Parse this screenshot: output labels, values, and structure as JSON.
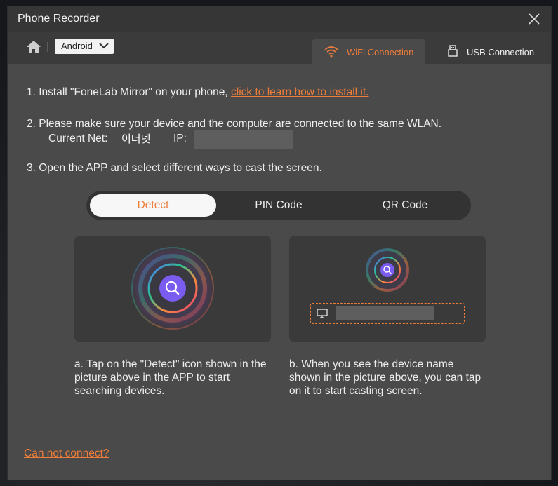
{
  "window": {
    "title": "Phone Recorder"
  },
  "toolbar": {
    "os_selected": "Android",
    "tabs": {
      "wifi": "WiFi Connection",
      "usb": "USB Connection"
    }
  },
  "steps": {
    "step1_text": "1. Install \"FoneLab Mirror\" on your phone, ",
    "step1_link": "click to learn how to install it.",
    "step2_text": "2. Please make sure your device and the computer are connected to the same WLAN.",
    "current_net_label": "Current Net:",
    "current_net_value": "이더넷",
    "ip_label": "IP:",
    "step3_text": "3. Open the APP and select different ways to cast the screen."
  },
  "methods": {
    "detect": "Detect",
    "pin": "PIN Code",
    "qr": "QR Code",
    "active": "Detect"
  },
  "captions": {
    "a": "a. Tap on the \"Detect\" icon shown in the picture above in the APP to start searching devices.",
    "b": "b. When you see the device name shown in the picture above, you can tap on it to start casting screen."
  },
  "footer": {
    "cannot_connect": "Can not connect?"
  },
  "colors": {
    "accent": "#ee7d3a",
    "panel": "#4a4a4a",
    "titlebar": "#363636"
  },
  "icons": [
    "home-icon",
    "chevron-down-icon",
    "wifi-icon",
    "usb-icon",
    "close-icon",
    "search-icon",
    "monitor-icon"
  ]
}
